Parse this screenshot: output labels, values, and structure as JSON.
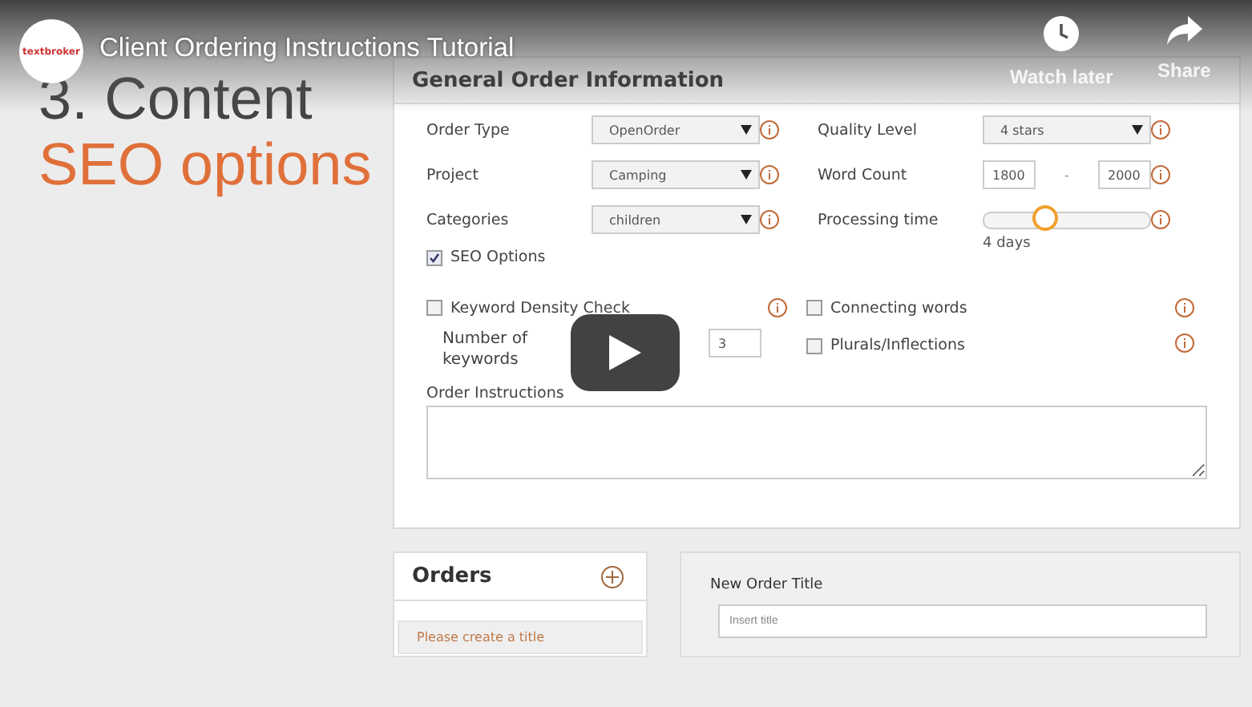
{
  "video": {
    "logo": "textbroker",
    "title": "Client Ordering Instructions Tutorial",
    "actions": [
      {
        "kind": "clock",
        "label": "Watch later"
      },
      {
        "kind": "share",
        "label": "Share"
      }
    ]
  },
  "slide": {
    "heading": "3. Content",
    "subheading": "SEO options"
  },
  "order_form": {
    "title": "General Order Information",
    "left_fields": [
      {
        "kind": "select",
        "label": "Order Type",
        "value": "OpenOrder"
      },
      {
        "kind": "select",
        "label": "Project",
        "value": "Camping"
      },
      {
        "kind": "select",
        "label": "Categories",
        "value": "children"
      }
    ],
    "right_fields": [
      {
        "kind": "select",
        "label": "Quality Level",
        "value": "4 stars"
      },
      {
        "kind": "range",
        "label": "Word Count",
        "from": "1800",
        "separator": "-",
        "to": "2000"
      },
      {
        "kind": "slider",
        "label": "Processing time",
        "level": 0.37,
        "reading": "4 days"
      }
    ],
    "seo_options": {
      "label": "SEO Options",
      "checked": true
    },
    "keyword_density": {
      "label": "Keyword Density Check",
      "checked": false
    },
    "number_of_keywords": {
      "label": "Number of keywords",
      "value": "3"
    },
    "seo_checks": [
      {
        "label": "Connecting words",
        "checked": false
      },
      {
        "label": "Plurals/Inflections",
        "checked": false
      }
    ],
    "instructions": {
      "label": "Order Instructions"
    }
  },
  "orders": {
    "title": "Orders",
    "items": [
      {
        "label": "Please create a title",
        "selected": true
      }
    ]
  },
  "new_order": {
    "label": "New Order Title",
    "placeholder": "Insert title"
  }
}
